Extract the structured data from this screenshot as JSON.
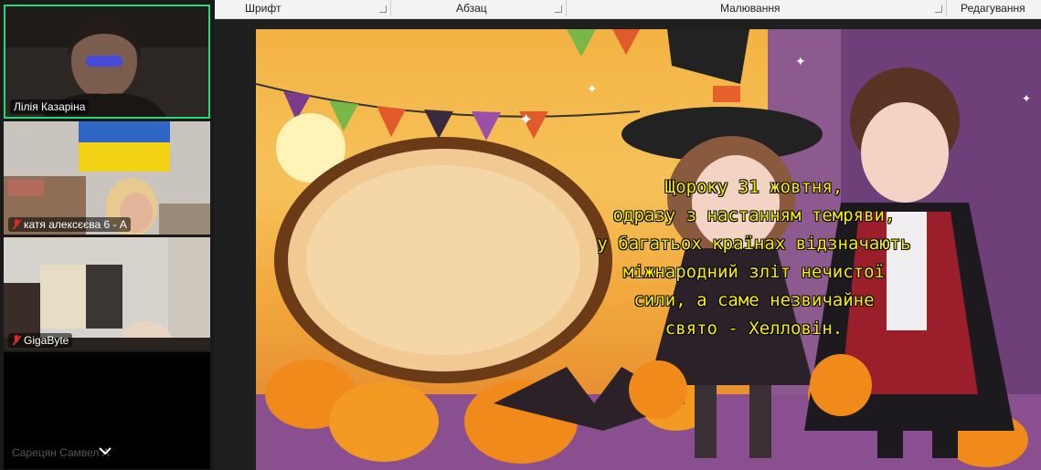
{
  "participants": [
    {
      "name": "Лілія Казаріна",
      "muted": false,
      "active": true
    },
    {
      "name": "катя алексєєва 6 - А",
      "muted": true,
      "active": false
    },
    {
      "name": "GigaByte",
      "muted": true,
      "active": false
    },
    {
      "name": "Сарецян Самвел А",
      "muted": false,
      "active": false
    }
  ],
  "ribbon": {
    "groups": [
      "Шрифт",
      "Абзац",
      "Малювання",
      "Редагування"
    ]
  },
  "slide": {
    "text": "Щороку 31 жовтня,\nодразу з настанням темряви,\nу багатьох країнах відзначають\nміжнародний зліт нечистої\nсили, а саме незвичайне\nсвято - Хелловін."
  },
  "colors": {
    "active_speaker_border": "#2bd67b",
    "muted_icon": "#e02828",
    "slide_text": "#f6f000"
  },
  "icons": {
    "scroll": "chevron-down-icon",
    "mic": "mic-off-icon"
  }
}
